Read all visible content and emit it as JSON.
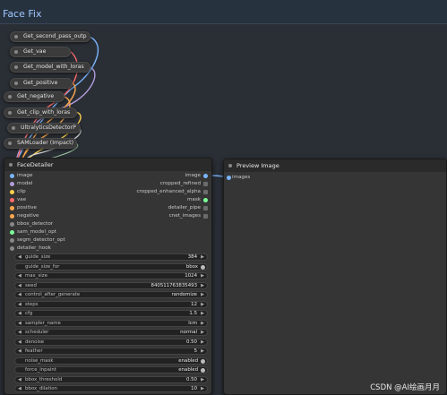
{
  "group": {
    "title": "Face Fix"
  },
  "get_nodes": [
    {
      "label": "Get_second_pass_outp"
    },
    {
      "label": "Get_vae"
    },
    {
      "label": "Get_model_with_loras"
    },
    {
      "label": "Get_positive"
    },
    {
      "label": "Get_negative"
    },
    {
      "label": "Get_clip_with_loras"
    },
    {
      "label": "UltralyticsDetectorP"
    },
    {
      "label": "SAMLoader (Impact)"
    }
  ],
  "face_detailer": {
    "title": "FaceDetailer",
    "inputs": [
      {
        "label": "image",
        "color": "#7ab6ff"
      },
      {
        "label": "model",
        "color": "#b39ddb"
      },
      {
        "label": "clip",
        "color": "#ffd24d"
      },
      {
        "label": "vae",
        "color": "#ff6b6b"
      },
      {
        "label": "positive",
        "color": "#ffa94d"
      },
      {
        "label": "negative",
        "color": "#ffa94d"
      },
      {
        "label": "bbox_detector",
        "color": "#888888"
      },
      {
        "label": "sam_model_opt",
        "color": "#7dff9a"
      },
      {
        "label": "segm_detector_opt",
        "color": "#888888"
      },
      {
        "label": "detailer_hook",
        "color": "#888888"
      }
    ],
    "outputs": [
      {
        "label": "image"
      },
      {
        "label": "cropped_refined"
      },
      {
        "label": "cropped_enhanced_alpha"
      },
      {
        "label": "mask"
      },
      {
        "label": "detailer_pipe"
      },
      {
        "label": "cnet_images"
      }
    ],
    "widgets": [
      {
        "label": "guide_size",
        "value": "384",
        "kind": "number"
      },
      {
        "label": "guide_size_for",
        "value": "bbox",
        "kind": "toggle"
      },
      {
        "label": "max_size",
        "value": "1024",
        "kind": "number"
      },
      {
        "label": "seed",
        "value": "840511763835493",
        "kind": "number"
      },
      {
        "label": "control_after_generate",
        "value": "randomize",
        "kind": "combo"
      },
      {
        "label": "steps",
        "value": "12",
        "kind": "number"
      },
      {
        "label": "cfg",
        "value": "1.5",
        "kind": "number"
      },
      {
        "label": "sampler_name",
        "value": "lcm",
        "kind": "combo"
      },
      {
        "label": "scheduler",
        "value": "normal",
        "kind": "combo"
      },
      {
        "label": "denoise",
        "value": "0.50",
        "kind": "number"
      },
      {
        "label": "feather",
        "value": "5",
        "kind": "number"
      },
      {
        "label": "noise_mask",
        "value": "enabled",
        "kind": "toggle"
      },
      {
        "label": "force_inpaint",
        "value": "enabled",
        "kind": "toggle"
      },
      {
        "label": "bbox_threshold",
        "value": "0.50",
        "kind": "number"
      },
      {
        "label": "bbox_dilation",
        "value": "10",
        "kind": "number"
      }
    ]
  },
  "preview_image": {
    "title": "Preview Image",
    "input_label": "images"
  },
  "watermark": "CSDN @AI绘画月月",
  "colors": {
    "group_title": "#9ec7ff",
    "image_wire": "#7ab6ff",
    "vae_wire": "#ff6b6b",
    "clip_wire": "#ffd24d",
    "conditioning_wire": "#ffa94d",
    "model_wire": "#b39ddb",
    "sam_wire": "#7dff9a"
  }
}
